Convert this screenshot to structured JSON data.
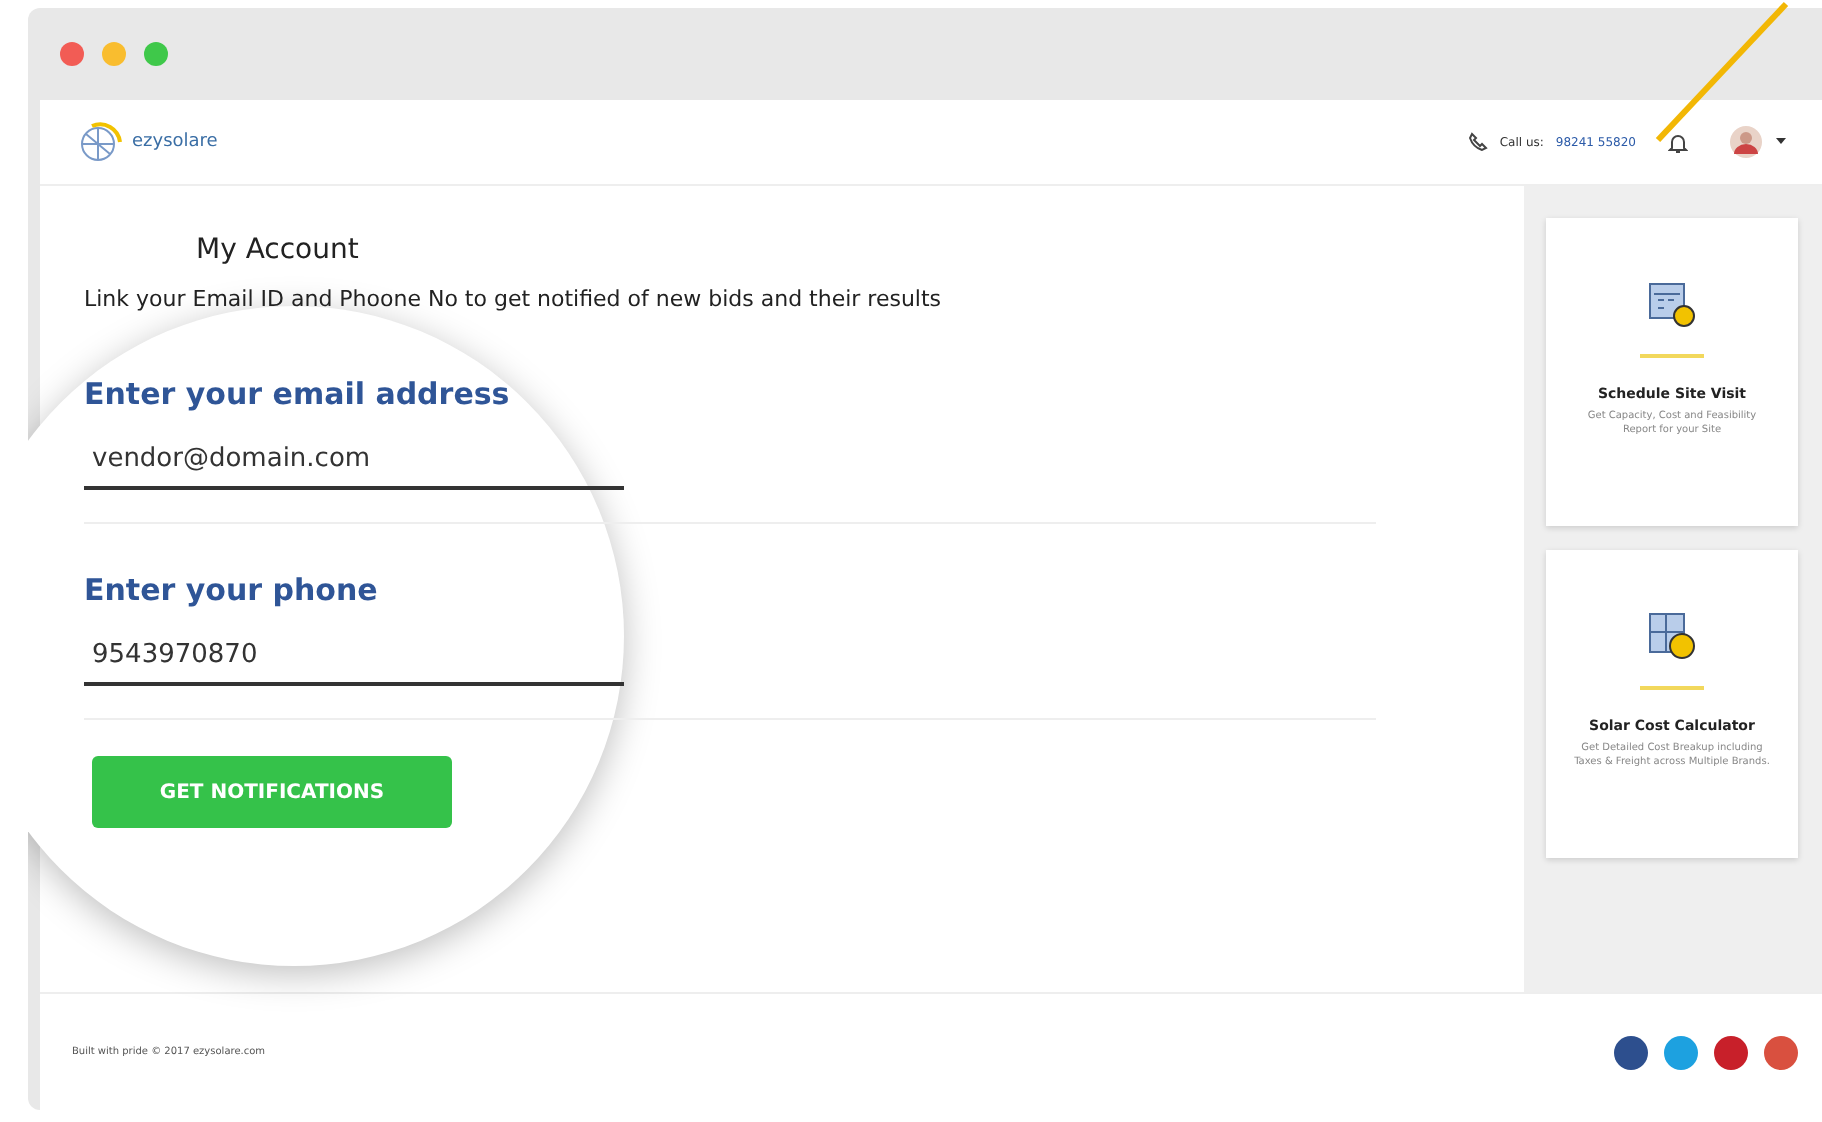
{
  "header": {
    "logo_text": "ezysolare",
    "call_label": "Call us:",
    "phone": "98241 55820"
  },
  "page": {
    "title": "My Account",
    "intro": "Link your Email ID and Phoone No to get notified of new bids and their results",
    "fields": [
      {
        "label": "Enter your email address",
        "value": "vendor@domain.com"
      },
      {
        "label": "Enter your phone",
        "value": "9543970870"
      }
    ],
    "button": "GET NOTIFICATIONS"
  },
  "sidebar": {
    "cards": [
      {
        "kind": "calendar",
        "title": "Schedule Site Visit",
        "description": "Get Capacity, Cost and Feasibility Report for your Site"
      },
      {
        "kind": "calculator",
        "title": "Solar Cost Calculator",
        "description": "Get Detailed Cost Breakup including Taxes & Freight across Multiple Brands."
      }
    ]
  },
  "footer": {
    "copyright": "Built with pride © 2017 ezysolare.com",
    "social": [
      {
        "color": "#2d4f8e"
      },
      {
        "color": "#1da1e0"
      },
      {
        "color": "#c8202a"
      },
      {
        "color": "#d9503f"
      }
    ]
  }
}
